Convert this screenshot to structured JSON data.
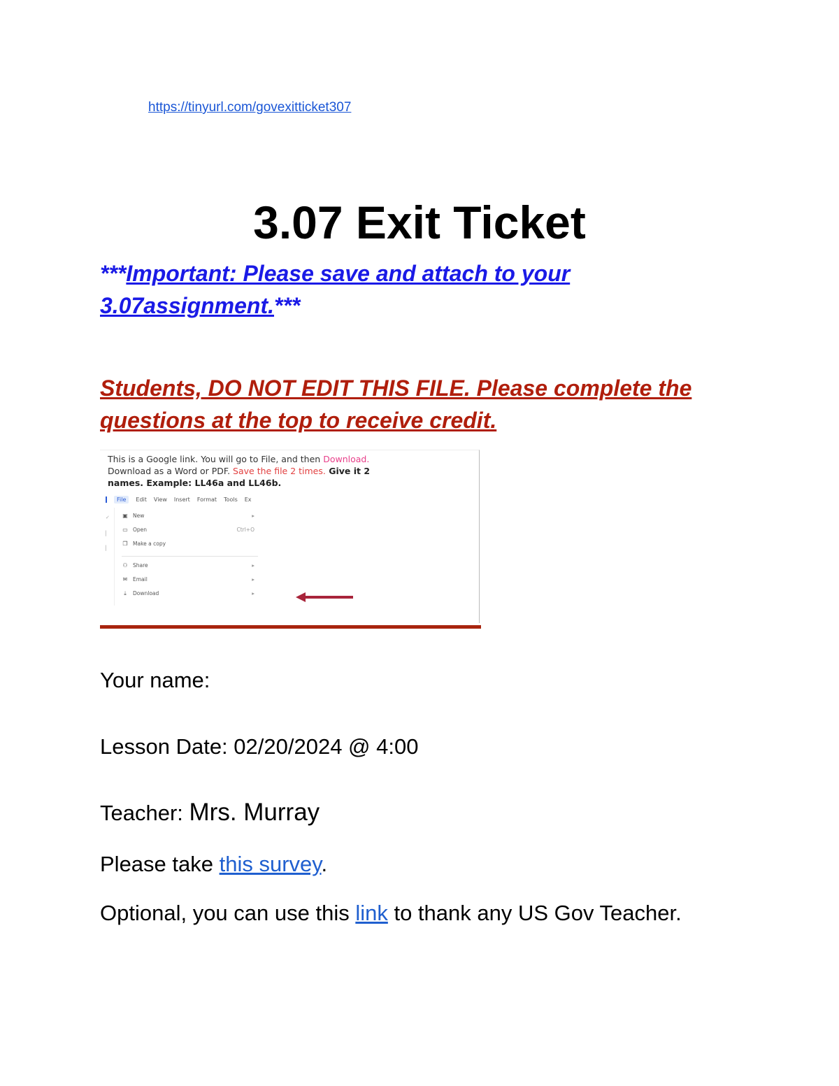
{
  "top_link": "https://tinyurl.com/govexitticket307",
  "title": "3.07 Exit Ticket",
  "important": {
    "prefix": "***",
    "text": "Important: Please save and attach to your 3.07assignment.",
    "suffix": "***"
  },
  "warning": "Students, DO NOT EDIT THIS FILE. Please complete the questions at the top to receive credit.",
  "figure": {
    "line1_a": "This is a Google link. You will go to  File, and then ",
    "line1_download": "Download.",
    "line2_a": "Download as a Word or PDF. ",
    "line2_save": "Save the file 2 times.",
    "line2_b": " Give it 2",
    "line3": "names. Example: LL46a and LL46b.",
    "menubar": [
      "File",
      "Edit",
      "View",
      "Insert",
      "Format",
      "Tools",
      "Ex"
    ],
    "menu_items": [
      {
        "icon": "new-icon",
        "label": "New",
        "right": "▸"
      },
      {
        "icon": "open-icon",
        "label": "Open",
        "right": "Ctrl+O"
      },
      {
        "icon": "copy-icon",
        "label": "Make a copy",
        "right": ""
      },
      {
        "icon": "share-icon",
        "label": "Share",
        "right": "▸"
      },
      {
        "icon": "email-icon",
        "label": "Email",
        "right": "▸"
      },
      {
        "icon": "download-icon",
        "label": "Download",
        "right": "▸"
      }
    ],
    "arrow_color": "#a8243a"
  },
  "your_name_label": "Your name:",
  "lesson_date": "Lesson Date: 02/20/2024 @ 4:00",
  "teacher_label": "Teacher: ",
  "teacher_name": "Mrs. Murray",
  "survey": {
    "before": "Please take ",
    "link": "this survey",
    "after": "."
  },
  "optional": {
    "before": "Optional, you can use this ",
    "link": "link",
    "after": " to thank any US Gov Teacher."
  },
  "colors": {
    "link_blue": "#1f5fcf",
    "important_blue": "#1a1ae6",
    "warning_red": "#b01e0c",
    "bar_red": "#a8240e"
  }
}
